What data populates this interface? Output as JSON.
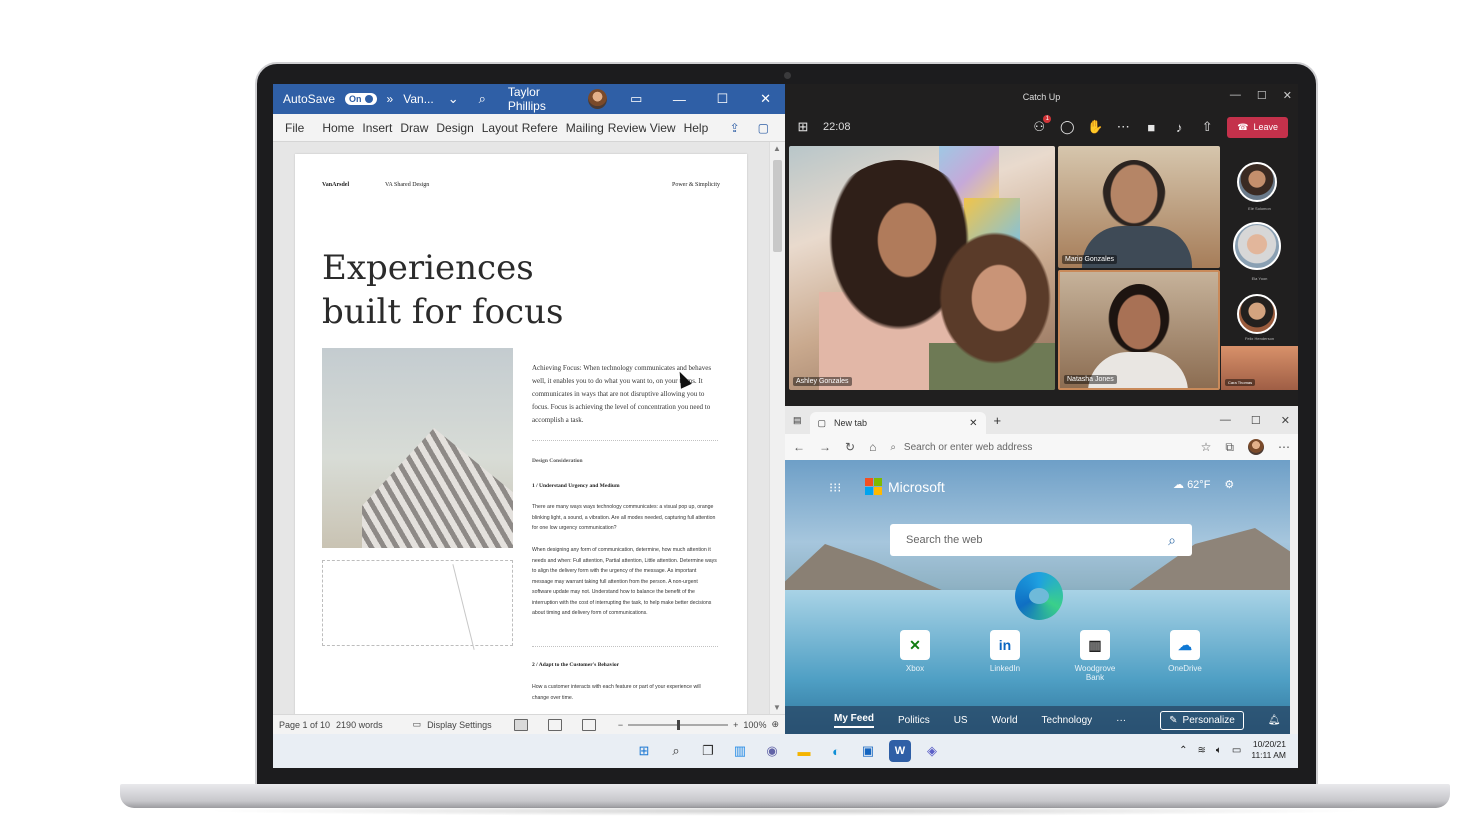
{
  "word": {
    "title_bar": {
      "autosave_label": "AutoSave",
      "autosave_state": "On",
      "more": "»",
      "doc_name": "Van...",
      "user_name": "Taylor Phillips"
    },
    "menu": [
      "File",
      "Home",
      "Insert",
      "Draw",
      "Design",
      "Layout",
      "Refere",
      "Mailing",
      "Review",
      "View",
      "Help"
    ],
    "page": {
      "header_brand": "VanArsdel",
      "header_center": "VA Shared Design",
      "header_right": "Power & Simplicity",
      "title": "Experiences built for focus",
      "lead": "Achieving Focus: When technology communicates and behaves well, it enables you to do what you want to, on your terms. It communicates in ways that are not disruptive allowing you to focus. Focus is achieving the level of concentration you need to accomplish a task.",
      "section": "Design Consideration",
      "h1": "1 / Understand Urgency and Medium",
      "p1": "There are many ways ways technology communicates: a visual pop up, orange blinking light, a sound, a vibration. Are all modes needed, capturing full attention for one low urgency communication?",
      "p2": "When designing any form of communication, determine, how much attention it needs and when: Full attention, Partial attention, Little attention. Determine ways to align the delivery form with the urgency of the message. As important message may warrant taking full attention from the person. A non-urgent software update may not. Understand how to balance the benefit of the interruption with the cost of interrupting the task, to help make better decisions about timing and delivery form of communications.",
      "h2": "2 / Adapt to the Customer's Behavior",
      "p3": "How a customer interacts with each feature or part of your experience will change over time."
    },
    "status": {
      "page": "Page 1 of 10",
      "words": "2190 words",
      "display": "Display Settings",
      "minus": "−",
      "plus": "+",
      "zoom": "100%"
    }
  },
  "teams": {
    "window_title": "Catch Up",
    "time": "22:08",
    "leave_label": "Leave",
    "notification_count": "1",
    "participants": {
      "main": "Ashley Gonzales",
      "tile1": "Mario Gonzales",
      "tile2": "Natasha Jones"
    },
    "side": [
      "Elé Solomon",
      "Ela Yoon",
      "Felix Henderson",
      "Cara Thomas"
    ]
  },
  "edge": {
    "tab_title": "New tab",
    "address_placeholder": "Search or enter web address",
    "brand": "Microsoft",
    "weather": "62°F",
    "search_placeholder": "Search the web",
    "tiles": [
      "Xbox",
      "LinkedIn",
      "Woodgrove Bank",
      "OneDrive"
    ],
    "feed": [
      "My Feed",
      "Politics",
      "US",
      "World",
      "Technology",
      "···"
    ],
    "personalize": "Personalize"
  },
  "taskbar": {
    "date": "10/20/21",
    "time": "11:11 AM"
  },
  "colors": {
    "word_blue": "#2f5fa6",
    "teams_dark": "#201f1f",
    "leave_red": "#c4314b",
    "ms_red": "#f25022",
    "ms_green": "#7fba00",
    "ms_blue": "#00a4ef",
    "ms_yellow": "#ffb900"
  }
}
